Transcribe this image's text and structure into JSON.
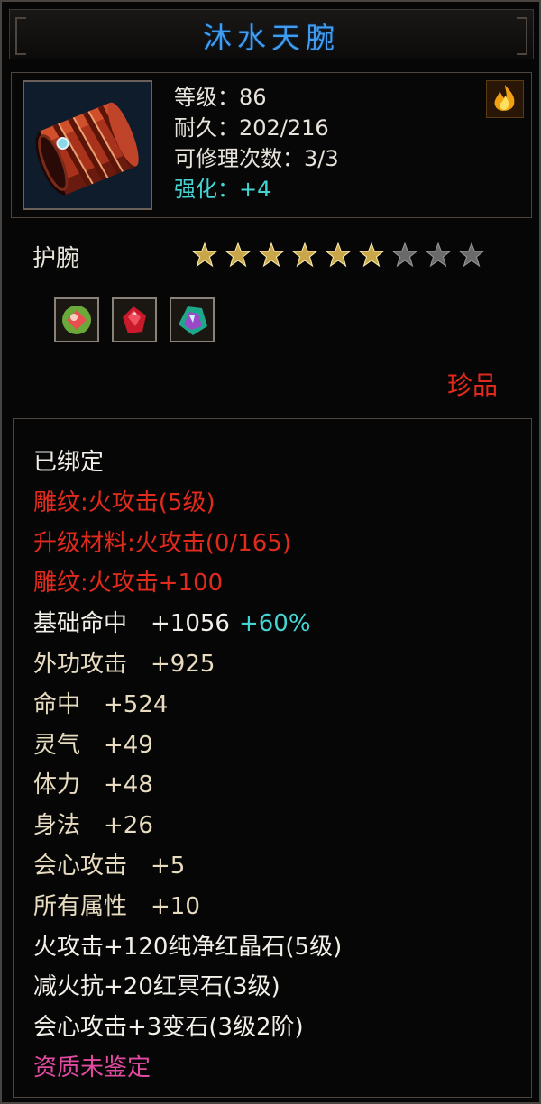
{
  "title": "沐水天腕",
  "header": {
    "icon": "bracer-item-icon",
    "level": "等级：86",
    "durability": "耐久：202/216",
    "repairs": "可修理次数：3/3",
    "enhance": "强化：+4",
    "corner_icon": "fire-element-icon"
  },
  "item_type": "护腕",
  "stars": {
    "filled": 6,
    "total": 9
  },
  "gems": [
    {
      "icon": "green-red-gem-icon"
    },
    {
      "icon": "red-crystal-gem-icon"
    },
    {
      "icon": "teal-crystal-gem-icon"
    }
  ],
  "rarity": "珍品",
  "attributes": [
    {
      "text": "已绑定",
      "style": ""
    },
    {
      "text": "雕纹:火攻击(5级)",
      "style": "red"
    },
    {
      "text": "升级材料:火攻击(0/165)",
      "style": "red"
    },
    {
      "text": "雕纹:火攻击+100",
      "style": "red"
    },
    {
      "text": "基础命中　+1056",
      "style": "",
      "extra": "+60%"
    },
    {
      "text": "外功攻击　+925",
      "style": "tan"
    },
    {
      "text": "命中　+524",
      "style": "tan"
    },
    {
      "text": "灵气　+49",
      "style": "tan"
    },
    {
      "text": "体力　+48",
      "style": "tan"
    },
    {
      "text": "身法　+26",
      "style": "tan"
    },
    {
      "text": "会心攻击　+5",
      "style": "tan"
    },
    {
      "text": "所有属性　+10",
      "style": "tan"
    },
    {
      "text": "火攻击+120纯净红晶石(5级)",
      "style": ""
    },
    {
      "text": "减火抗+20红冥石(3级)",
      "style": ""
    },
    {
      "text": "会心攻击+3变石(3级2阶)",
      "style": ""
    },
    {
      "text": "资质未鉴定",
      "style": "pink"
    }
  ],
  "colors": {
    "title": "#3f9cf0",
    "red": "#e02a1c",
    "cyan": "#44d4d4",
    "pink": "#e04aa0",
    "star": "#c9a64a"
  }
}
